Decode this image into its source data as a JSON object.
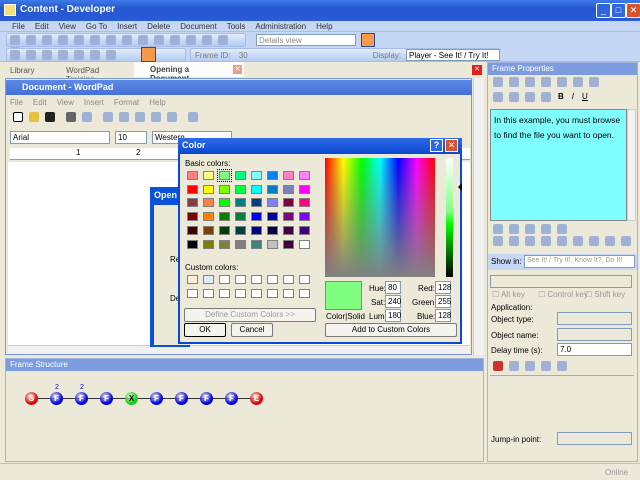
{
  "window": {
    "title": "Content - Developer",
    "min": "_",
    "max": "□",
    "close": "✕"
  },
  "menu": [
    "File",
    "Edit",
    "View",
    "Go To",
    "Insert",
    "Delete",
    "Document",
    "Tools",
    "Administration",
    "Help"
  ],
  "toolbar": {
    "view_select": "Details view",
    "frame_id_label": "Frame ID:",
    "frame_id": "30",
    "display_label": "Display:",
    "display_value": "Player - See It! / Try It!"
  },
  "tabs": [
    {
      "label": "Library"
    },
    {
      "label": "WordPad Training"
    },
    {
      "label": "Opening a Document"
    }
  ],
  "wordpad": {
    "title": "Document - WordPad",
    "menu": [
      "File",
      "Edit",
      "View",
      "Insert",
      "Format",
      "Help"
    ],
    "font": "Arial",
    "size": "10",
    "script": "Western",
    "ruler": [
      "1",
      "2"
    ]
  },
  "open_dialog": {
    "title": "Open",
    "items": [
      "Re",
      "De"
    ]
  },
  "color_dialog": {
    "title": "Color",
    "help": "?",
    "close": "✕",
    "basic_label": "Basic colors:",
    "custom_label": "Custom colors:",
    "basic_colors": [
      "#FF8080",
      "#FFFF80",
      "#80FF80",
      "#00FF80",
      "#80FFFF",
      "#0080FF",
      "#FF80C0",
      "#FF80FF",
      "#FF0000",
      "#FFFF00",
      "#80FF00",
      "#00FF40",
      "#00FFFF",
      "#0080C0",
      "#8080C0",
      "#FF00FF",
      "#804040",
      "#FF8040",
      "#00FF00",
      "#008080",
      "#004080",
      "#8080FF",
      "#800040",
      "#FF0080",
      "#800000",
      "#FF8000",
      "#008000",
      "#008040",
      "#0000FF",
      "#0000A0",
      "#800080",
      "#8000FF",
      "#400000",
      "#804000",
      "#004000",
      "#004040",
      "#000080",
      "#000040",
      "#400040",
      "#400080",
      "#000000",
      "#808000",
      "#808040",
      "#808080",
      "#408080",
      "#C0C0C0",
      "#400040",
      "#FFFFFF"
    ],
    "custom_colors": [
      "#F8F0D8",
      "#E0ECF8",
      "#FFFFFF",
      "#FFFFFF",
      "#FFFFFF",
      "#FFFFFF",
      "#FFFFFF",
      "#FFFFFF",
      "#FFFFFF",
      "#FFFFFF",
      "#FFFFFF",
      "#FFFFFF",
      "#FFFFFF",
      "#FFFFFF",
      "#FFFFFF",
      "#FFFFFF"
    ],
    "define_custom": "Define Custom Colors >>",
    "ok": "OK",
    "cancel": "Cancel",
    "color_solid": "Color|Solid",
    "current_color": "#80FF80",
    "hue_label": "Hue:",
    "hue": "80",
    "sat_label": "Sat:",
    "sat": "240",
    "lum_label": "Lum:",
    "lum": "180",
    "red_label": "Red:",
    "red": "128",
    "green_label": "Green:",
    "green": "255",
    "blue_label": "Blue:",
    "blue": "128",
    "add_custom": "Add to Custom Colors"
  },
  "frame_structure": {
    "title": "Frame Structure",
    "nodes": [
      {
        "l": "S",
        "c": "#e00000"
      },
      {
        "l": "F",
        "c": "#0000e0",
        "n": "2"
      },
      {
        "l": "F",
        "c": "#0000e0",
        "n": "2"
      },
      {
        "l": "F",
        "c": "#0000e0"
      },
      {
        "l": "X",
        "c": "#10d010"
      },
      {
        "l": "F",
        "c": "#0000e0"
      },
      {
        "l": "F",
        "c": "#0000e0"
      },
      {
        "l": "F",
        "c": "#0000e0"
      },
      {
        "l": "F",
        "c": "#0000e0"
      },
      {
        "l": "E",
        "c": "#e00000"
      }
    ]
  },
  "frame_properties": {
    "title": "Frame Properties",
    "text": "In this example, you must browse to find the file you want to open.",
    "show_in_label": "Show in:",
    "show_in": "See It! / Try It!, Know It?, Do It!",
    "alt": "Alt key",
    "ctrl": "Control key",
    "shift": "Shift key",
    "application": "Application:",
    "object_type": "Object type:",
    "object_name": "Object name:",
    "delay_label": "Delay time (s):",
    "delay": "7.0",
    "jump_in": "Jump-in point:",
    "status": "Online"
  }
}
